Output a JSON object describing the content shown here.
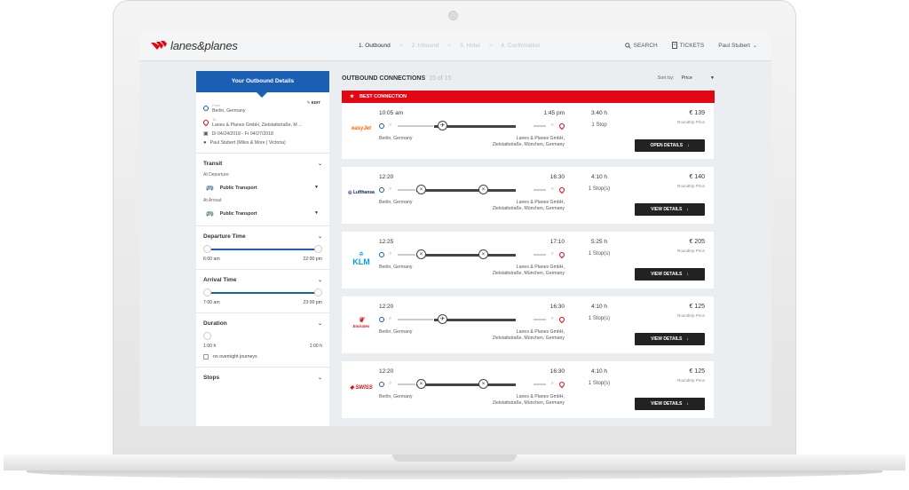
{
  "header": {
    "logo_text": "lanes&planes",
    "steps": [
      "1. Outbound",
      "2. Inbound",
      "3. Hotel",
      "4. Confirmation"
    ],
    "nav_search": "SEARCH",
    "nav_tickets": "TICKETS",
    "user_name": "Paul Stubert"
  },
  "sidebar": {
    "title": "Your Outbound Details",
    "edit_label": "EDIT",
    "from_label": "From",
    "from_value": "Berlin, Germany",
    "to_label": "To",
    "to_value": "Lanes & Planes GmbH, Zielstattstraße, M ...",
    "dates": "Di 04/24/2018 - Fr 04/27/2018",
    "traveler": "Paul Stubert (Miles & More | Victoria)",
    "transit_title": "Transit",
    "at_departure_label": "At Departure:",
    "at_departure_value": "Public Transport",
    "at_arrival_label": "At Arrival:",
    "at_arrival_value": "Public Transport",
    "departure_time_title": "Departure Time",
    "departure_min": "6:00 am",
    "departure_max": "22:00 pm",
    "arrival_time_title": "Arrival Time",
    "arrival_min": "7:00 am",
    "arrival_max": "23:00 pm",
    "duration_title": "Duration",
    "duration_min": "1:00 h",
    "duration_max": "1:00 h",
    "overnight_label": "no overnight journeys",
    "stops_title": "Stops"
  },
  "main": {
    "title": "OUTBOUND CONNECTIONS",
    "count": "15 of 15",
    "sort_label": "Sort by:",
    "sort_value": "Price",
    "best_label": "BEST CONNECTION",
    "roundtrip_label": "Roundtrip Price",
    "connections": [
      {
        "airline": "easyJet",
        "airline_color": "#ff6600",
        "dep": "10:05 am",
        "arr": "1:45 pm",
        "duration": "3:40 h",
        "stops": "1 Stop",
        "price": "€ 139",
        "from": "Berlin, Germany",
        "to_line1": "Lanes & Planes GmbH,",
        "to_line2": "Zielstattstraße, München, Germany",
        "button": "OPEN DETAILS"
      },
      {
        "airline": "Lufthansa",
        "airline_color": "#0a1d5c",
        "dep": "12:20",
        "arr": "16:30",
        "duration": "4:10 h",
        "stops": "1 Stop(s)",
        "price": "€ 140",
        "from": "Berlin, Germany",
        "to_line1": "Lanes & Planes GmbH,",
        "to_line2": "Zielstattstraße, München, Germany",
        "button": "VIEW DETAILS"
      },
      {
        "airline": "KLM",
        "airline_color": "#00a1de",
        "dep": "12:25",
        "arr": "17:10",
        "duration": "5:25 h",
        "stops": "1 Stop(s)",
        "price": "€ 205",
        "from": "Berlin, Germany",
        "to_line1": "Lanes & Planes GmbH,",
        "to_line2": "Zielstattstraße, München, Germany",
        "button": "VIEW DETAILS"
      },
      {
        "airline": "Emirates",
        "airline_color": "#d71921",
        "dep": "12:20",
        "arr": "16:30",
        "duration": "4:10 h",
        "stops": "1 Stop(s)",
        "price": "€ 125",
        "from": "Berlin, Germany",
        "to_line1": "Lanes & Planes GmbH,",
        "to_line2": "Zielstattstraße, München, Germany",
        "button": "VIEW DETAILS"
      },
      {
        "airline": "SWISS",
        "airline_color": "#e30613",
        "dep": "12:20",
        "arr": "16:30",
        "duration": "4:10 h",
        "stops": "1 Stop(s)",
        "price": "€ 125",
        "from": "Berlin, Germany",
        "to_line1": "Lanes & Planes GmbH,",
        "to_line2": "Zielstattstraße, München, Germany",
        "button": "VIEW DETAILS"
      }
    ]
  }
}
